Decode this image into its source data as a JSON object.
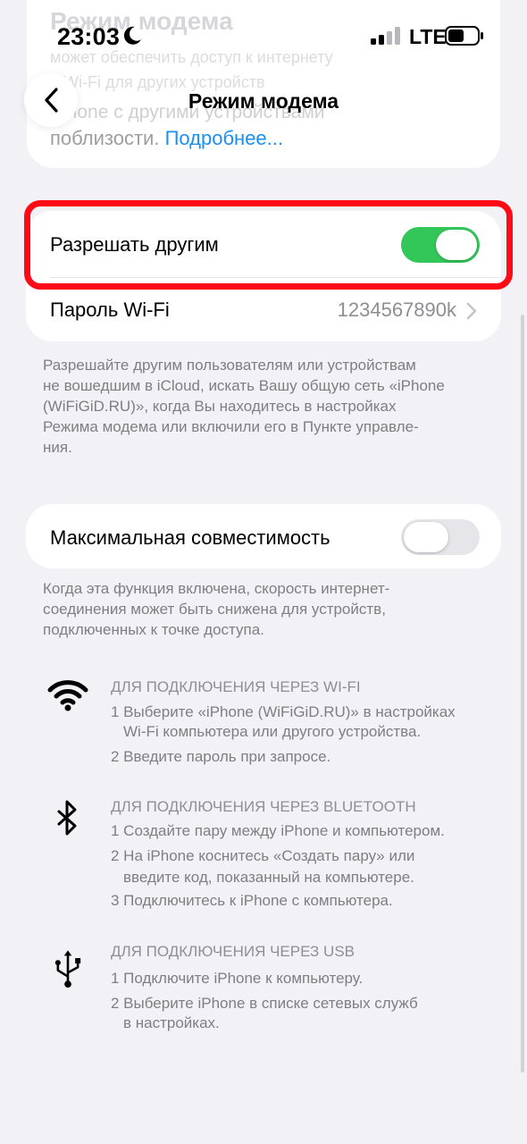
{
  "status_bar": {
    "time": "23:03",
    "network": "LTE"
  },
  "ghost": {
    "title": "Режим модема",
    "line1": "может обеспечить доступ к интернету",
    "line2": "и Wi-Fi для других устройств",
    "line3": "iPhone с другими устройствами",
    "line4": "поблизости.",
    "link": "Подробнее..."
  },
  "nav": {
    "title": "Режим модема"
  },
  "main_card": {
    "allow_others_label": "Разрешать другим",
    "allow_others_on": true,
    "wifi_password_label": "Пароль Wi-Fi",
    "wifi_password_value": "1234567890k"
  },
  "footnote1": [
    "Разрешайте другим пользователям или устройствам",
    "не вошедшим в iCloud, искать Вашу общую сеть «iPhone",
    "(WiFiGiD.RU)», когда Вы находитесь в настройках",
    "Режима модема или включили его в Пункте управле-",
    "ния."
  ],
  "compat_card": {
    "label": "Максимальная совместимость",
    "on": false
  },
  "footnote2": [
    "Когда эта функция включена, скорость интернет-",
    "соединения может быть снижена для устройств,",
    "подключенных к точке доступа."
  ],
  "sections": {
    "wifi": {
      "heading": "ДЛЯ ПОДКЛЮЧЕНИЯ ЧЕРЕЗ WI-FI",
      "steps": [
        "1 Выберите «iPhone (WiFiGiD.RU)» в настройках",
        "Wi-Fi компьютера или другого устройства.",
        "2 Введите пароль при запросе."
      ]
    },
    "bluetooth": {
      "heading": "ДЛЯ ПОДКЛЮЧЕНИЯ ЧЕРЕЗ BLUETOOTH",
      "steps": [
        "1 Создайте пару между iPhone и компьютером.",
        "2 На iPhone коснитесь «Создать пару» или",
        "введите код, показанный на компьютере.",
        "3 Подключитесь к iPhone с компьютера."
      ]
    },
    "usb": {
      "heading": "ДЛЯ ПОДКЛЮЧЕНИЯ ЧЕРЕЗ USB",
      "steps": [
        "1 Подключите iPhone к компьютеру.",
        "2 Выберите iPhone в списке сетевых служб",
        "в настройках."
      ]
    }
  },
  "colors": {
    "accent": "#33c759",
    "link": "#1a8ff5",
    "highlight": "#ff0a16"
  },
  "icons": [
    "moon-icon",
    "signal-icon",
    "battery-icon",
    "back-chevron-icon",
    "chevron-right-icon",
    "wifi-icon",
    "bluetooth-icon",
    "usb-icon"
  ]
}
